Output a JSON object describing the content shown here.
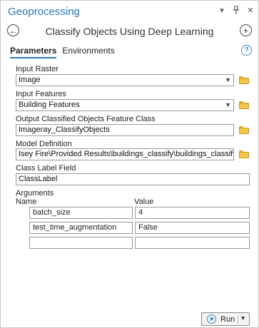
{
  "pane": {
    "title": "Geoprocessing",
    "menu_icon": "▾",
    "pin_icon": "pin-icon",
    "close_icon": "✕"
  },
  "tool": {
    "title": "Classify Objects Using Deep Learning",
    "back_icon": "←",
    "add_icon": "+"
  },
  "tabs": {
    "parameters": "Parameters",
    "environments": "Environments",
    "help_icon": "?"
  },
  "params": {
    "input_raster": {
      "label": "Input Raster",
      "value": "Image"
    },
    "input_features": {
      "label": "Input Features",
      "value": "Building Features"
    },
    "output_class": {
      "label": "Output Classified Objects Feature Class",
      "value": "Imageray_ClassifyObjects"
    },
    "model_def": {
      "label": "Model Definition",
      "value": "Isey Fire\\Provided Results\\buildings_classify\\buildings_classify.emd"
    },
    "class_label": {
      "label": "Class Label Field",
      "value": "ClassLabel"
    }
  },
  "arguments": {
    "label": "Arguments",
    "col_name": "Name",
    "col_value": "Value",
    "rows": [
      {
        "name": "batch_size",
        "value": "4"
      },
      {
        "name": "test_time_augmentation",
        "value": "False"
      },
      {
        "name": "",
        "value": ""
      }
    ]
  },
  "run": {
    "label": "Run"
  },
  "colors": {
    "accent": "#2a77b8",
    "folder": "#f0c64a"
  }
}
